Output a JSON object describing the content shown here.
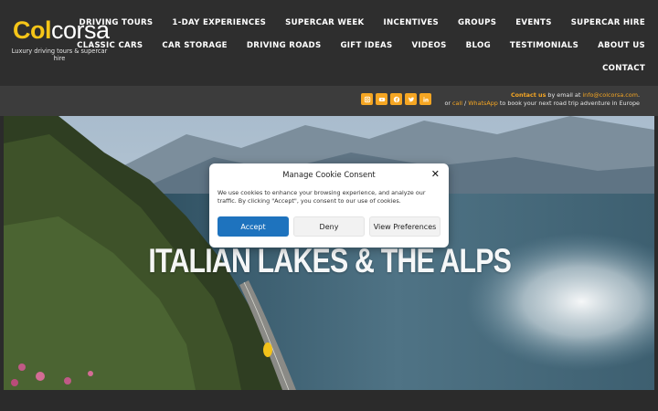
{
  "brand": {
    "logo_part1": "Col",
    "logo_part2": "corsa",
    "tagline": "Luxury driving tours & supercar hire",
    "accent": "#f5c518"
  },
  "nav": {
    "row1": [
      "DRIVING TOURS",
      "1-DAY EXPERIENCES",
      "SUPERCAR WEEK",
      "INCENTIVES",
      "GROUPS",
      "EVENTS",
      "SUPERCAR HIRE"
    ],
    "row2": [
      "CLASSIC CARS",
      "CAR STORAGE",
      "DRIVING ROADS",
      "GIFT IDEAS",
      "VIDEOS",
      "BLOG",
      "TESTIMONIALS",
      "ABOUT US"
    ],
    "row3": [
      "CONTACT"
    ]
  },
  "contact": {
    "contact_us": "Contact us",
    "by_email": " by email at ",
    "email": "info@colcorsa.com",
    "period": ".",
    "or": "or ",
    "call": "call",
    "slash": " / ",
    "whatsapp": "WhatsApp",
    "rest": " to book your next road trip adventure in Europe"
  },
  "socials": [
    "instagram-icon",
    "youtube-icon",
    "facebook-icon",
    "twitter-icon",
    "linkedin-icon"
  ],
  "hero": {
    "title": "ITALIAN LAKES & THE ALPS"
  },
  "cookie_modal": {
    "title": "Manage Cookie Consent",
    "body": "We use cookies to enhance your browsing experience, and analyze our traffic. By clicking \"Accept\", you consent to our use of cookies.",
    "accept": "Accept",
    "deny": "Deny",
    "preferences": "View Preferences",
    "accept_color": "#1e73be"
  }
}
